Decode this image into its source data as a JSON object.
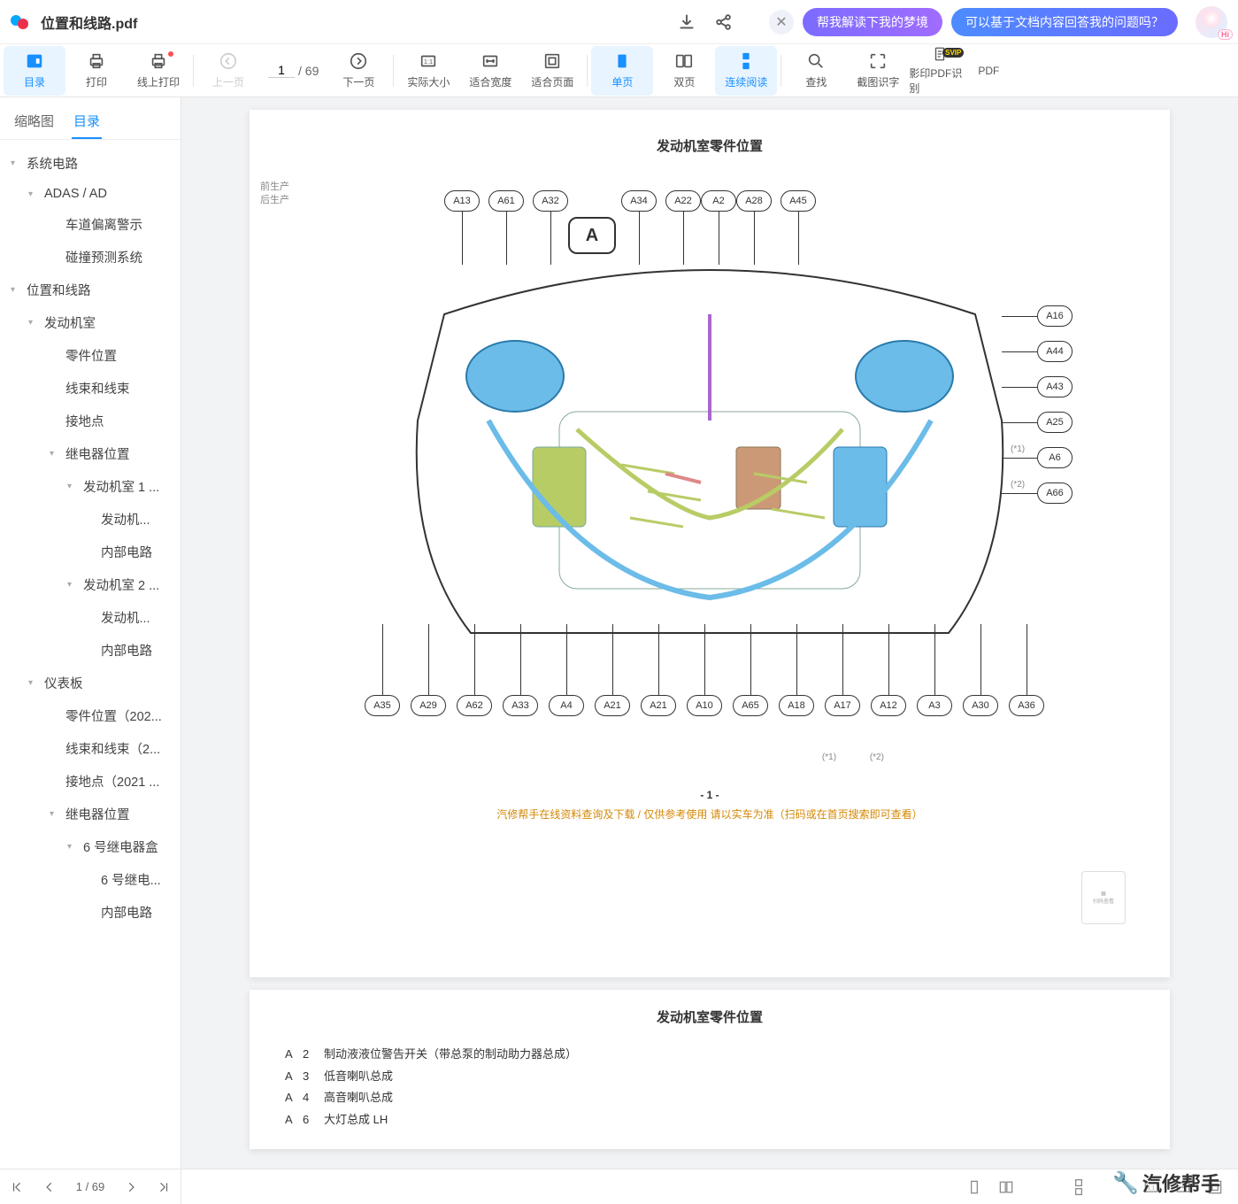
{
  "titlebar": {
    "doc_title": "位置和线路.pdf",
    "pill1": "帮我解读下我的梦境",
    "pill2": "可以基于文档内容回答我的问题吗？",
    "hi": "Hi"
  },
  "toolbar": {
    "catalog": "目录",
    "print": "打印",
    "online_print": "线上打印",
    "prev": "上一页",
    "page_current": "1",
    "page_sep": "/ 69",
    "next": "下一页",
    "actual": "实际大小",
    "fit_width": "适合宽度",
    "fit_page": "适合页面",
    "single": "单页",
    "double": "双页",
    "continuous": "连续阅读",
    "find": "查找",
    "ocr_crop": "截图识字",
    "ocr_pdf": "影印PDF识别",
    "svip": "SVIP",
    "pdf_suffix": "PDF"
  },
  "sidebar": {
    "tab_thumb": "缩略图",
    "tab_toc": "目录",
    "items": [
      {
        "l": 0,
        "c": "▾",
        "t": "系统电路"
      },
      {
        "l": 1,
        "c": "▾",
        "t": "ADAS / AD"
      },
      {
        "l": 2,
        "c": "",
        "t": "车道偏离警示"
      },
      {
        "l": 2,
        "c": "",
        "t": "碰撞预测系统"
      },
      {
        "l": 0,
        "c": "▾",
        "t": "位置和线路"
      },
      {
        "l": 1,
        "c": "▾",
        "t": "发动机室"
      },
      {
        "l": 2,
        "c": "",
        "t": "零件位置"
      },
      {
        "l": 2,
        "c": "",
        "t": "线束和线束"
      },
      {
        "l": 2,
        "c": "",
        "t": "接地点"
      },
      {
        "l": 2,
        "c": "▾",
        "t": "继电器位置"
      },
      {
        "l": 3,
        "c": "▾",
        "t": "发动机室 1 ..."
      },
      {
        "l": 4,
        "c": "",
        "t": "发动机..."
      },
      {
        "l": 4,
        "c": "",
        "t": "内部电路"
      },
      {
        "l": 3,
        "c": "▾",
        "t": "发动机室 2 ..."
      },
      {
        "l": 4,
        "c": "",
        "t": "发动机..."
      },
      {
        "l": 4,
        "c": "",
        "t": "内部电路"
      },
      {
        "l": 1,
        "c": "▾",
        "t": "仪表板"
      },
      {
        "l": 2,
        "c": "",
        "t": "零件位置（202..."
      },
      {
        "l": 2,
        "c": "",
        "t": "线束和线束（2..."
      },
      {
        "l": 2,
        "c": "",
        "t": "接地点（2021 ..."
      },
      {
        "l": 2,
        "c": "▾",
        "t": "继电器位置"
      },
      {
        "l": 3,
        "c": "▾",
        "t": "6 号继电器盒"
      },
      {
        "l": 4,
        "c": "",
        "t": "6 号继电..."
      },
      {
        "l": 4,
        "c": "",
        "t": "内部电路"
      }
    ],
    "footer_page": "1",
    "footer_total": "/ 69"
  },
  "doc": {
    "page1_title": "发动机室零件位置",
    "note_l1": "前生产",
    "note_l2": "后生产",
    "big_label": "A",
    "top_labels": [
      "A13",
      "A61",
      "A32",
      "A34",
      "A22",
      "A2",
      "A28",
      "A45"
    ],
    "right_labels": [
      "A16",
      "A44",
      "A43",
      "A25",
      "A6",
      "A66"
    ],
    "right_notes": [
      "(*1)",
      "(*2)"
    ],
    "bottom_labels": [
      "A35",
      "A29",
      "A62",
      "A33",
      "A4",
      "A21",
      "A21",
      "A10",
      "A65",
      "A18",
      "A17",
      "A12",
      "A3",
      "A30",
      "A36"
    ],
    "bottom_notes": [
      "(*1)",
      "(*2)"
    ],
    "page_num": "- 1 -",
    "orange": "汽修帮手在线资料查询及下载 / 仅供参考使用 请以实车为准（扫码或在首页搜索即可查看）",
    "page2_title": "发动机室零件位置",
    "parts": [
      {
        "c": "A",
        "n": "2",
        "d": "制动液液位警告开关（带总泵的制动助力器总成）"
      },
      {
        "c": "A",
        "n": "3",
        "d": "低音喇叭总成"
      },
      {
        "c": "A",
        "n": "4",
        "d": "高音喇叭总成"
      },
      {
        "c": "A",
        "n": "6",
        "d": "大灯总成 LH"
      }
    ]
  },
  "watermark": "汽修帮手"
}
